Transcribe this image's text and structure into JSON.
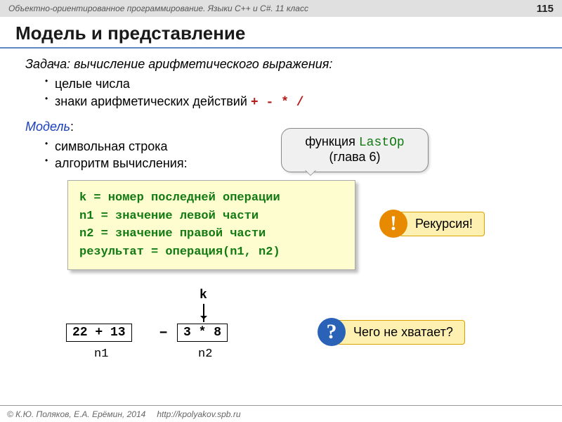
{
  "header": {
    "course": "Объектно-ориентированное программирование. Языки C++ и C#. 11 класс",
    "page": "115"
  },
  "title": "Модель и представление",
  "task": {
    "lead_label": "Задача",
    "lead_text": ": вычисление арифметического выражения:",
    "bullets": [
      "целые числа",
      "знаки арифметических действий "
    ],
    "ops": "+  -  *  /"
  },
  "model": {
    "label": "Модель",
    "colon": ":",
    "bullets": [
      "символьная строка",
      "алгоритм вычисления:"
    ]
  },
  "bubble": {
    "line1_pre": "функция ",
    "line1_fn": "LastOp",
    "line2": "(глава 6)"
  },
  "code": {
    "l1": "k = номер последней операции",
    "l2": "n1 = значение левой части",
    "l3": "n2 = значение правой части",
    "l4": "результат = операция(n1, n2)"
  },
  "callouts": {
    "rec_icon": "!",
    "rec_text": "Рекурсия!",
    "miss_icon": "?",
    "miss_text": "Чего не хватает?"
  },
  "diagram": {
    "k": "k",
    "expr1": "22 + 13",
    "minus": "–",
    "expr2": "3 * 8",
    "n1": "n1",
    "n2": "n2"
  },
  "footer": {
    "copyright": "© К.Ю. Поляков, Е.А. Ерёмин, 2014",
    "url": "http://kpolyakov.spb.ru"
  }
}
